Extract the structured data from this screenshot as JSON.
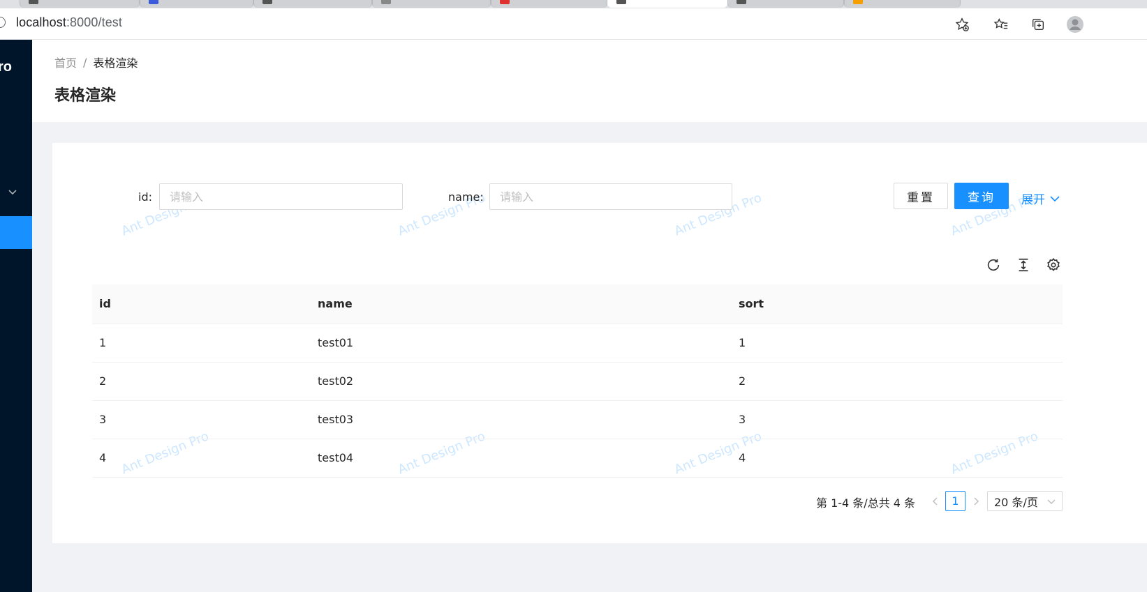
{
  "browser": {
    "url_host": "localhost",
    "url_rest": ":8000/test"
  },
  "sidebar": {
    "logo_text": "ro"
  },
  "breadcrumb": {
    "home": "首页",
    "separator": "/",
    "current": "表格渲染"
  },
  "page": {
    "title": "表格渲染"
  },
  "watermark": {
    "text": "Ant Design Pro"
  },
  "search_form": {
    "id_label": "id:",
    "id_placeholder": "请输入",
    "name_label": "name:",
    "name_placeholder": "请输入",
    "reset_label": "重置",
    "query_label": "查询",
    "expand_label": "展开"
  },
  "toolbar": {
    "icons": [
      "reload-icon",
      "column-height-icon",
      "setting-icon"
    ]
  },
  "table": {
    "columns": [
      "id",
      "name",
      "sort"
    ],
    "rows": [
      [
        "1",
        "test01",
        "1"
      ],
      [
        "2",
        "test02",
        "2"
      ],
      [
        "3",
        "test03",
        "3"
      ],
      [
        "4",
        "test04",
        "4"
      ]
    ]
  },
  "pagination": {
    "total_text": "第 1-4 条/总共 4 条",
    "current_page": "1",
    "page_size": "20 条/页"
  },
  "colors": {
    "primary": "#1890ff",
    "sidebar_bg": "#001529",
    "page_bg": "#f0f2f5"
  }
}
